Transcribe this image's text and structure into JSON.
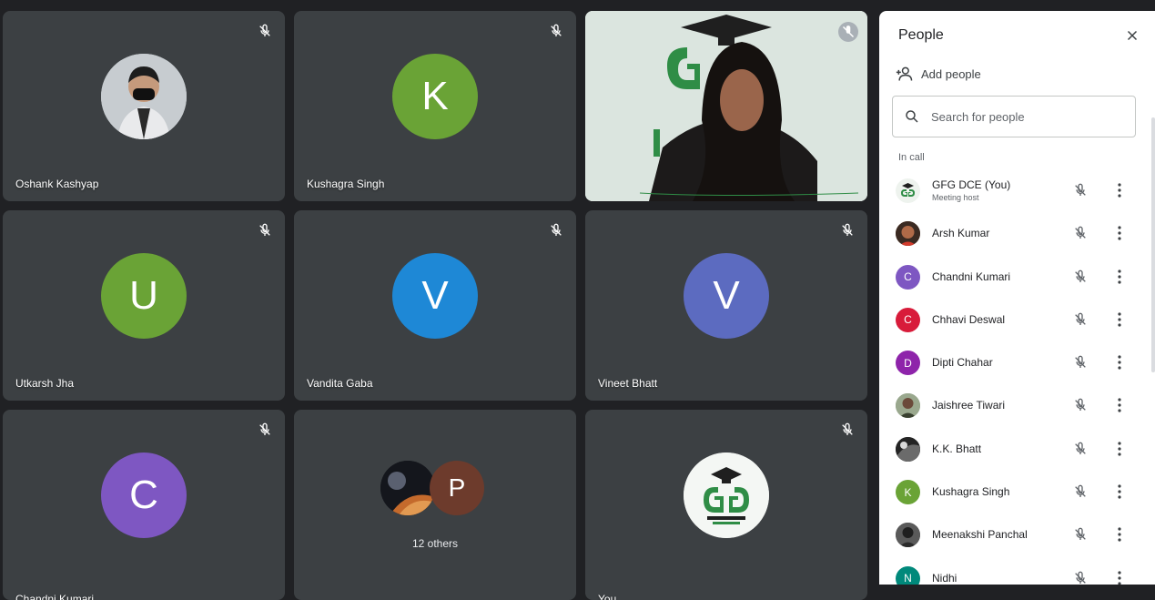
{
  "tiles": [
    {
      "name": "Oshank Kashyap",
      "kind": "photo",
      "avatar": "person-photo-icon"
    },
    {
      "name": "Kushagra Singh",
      "kind": "letter",
      "letter": "K",
      "color": "#6aa336"
    },
    {
      "name": "",
      "kind": "video"
    },
    {
      "name": "Utkarsh Jha",
      "kind": "letter",
      "letter": "U",
      "color": "#6aa336"
    },
    {
      "name": "Vandita Gaba",
      "kind": "letter",
      "letter": "V",
      "color": "#1e88d6"
    },
    {
      "name": "Vineet Bhatt",
      "kind": "letter",
      "letter": "V",
      "color": "#5c6bc0"
    },
    {
      "name": "Chandni Kumari",
      "kind": "letter",
      "letter": "C",
      "color": "#7e57c2"
    },
    {
      "name": "12 others",
      "kind": "others",
      "letter": "P"
    },
    {
      "name": "You",
      "kind": "logo"
    }
  ],
  "panel": {
    "title": "People",
    "add_people": "Add people",
    "search_placeholder": "Search for people",
    "section": "In call",
    "participants": [
      {
        "name": "GFG DCE (You)",
        "sub": "Meeting host",
        "avatar": "logo",
        "color": "#e8f0e8"
      },
      {
        "name": "Arsh Kumar",
        "sub": "",
        "avatar": "photo",
        "color": "#8b4a2c"
      },
      {
        "name": "Chandni Kumari",
        "sub": "",
        "avatar": "C",
        "color": "#7e57c2"
      },
      {
        "name": "Chhavi Deswal",
        "sub": "",
        "avatar": "C",
        "color": "#d81b3a"
      },
      {
        "name": "Dipti Chahar",
        "sub": "",
        "avatar": "D",
        "color": "#8e24aa"
      },
      {
        "name": "Jaishree Tiwari",
        "sub": "",
        "avatar": "photo",
        "color": "#7a8f6f"
      },
      {
        "name": "K.K. Bhatt",
        "sub": "",
        "avatar": "photo",
        "color": "#3a3a3a"
      },
      {
        "name": "Kushagra Singh",
        "sub": "",
        "avatar": "K",
        "color": "#6aa336"
      },
      {
        "name": "Meenakshi Panchal",
        "sub": "",
        "avatar": "photo",
        "color": "#4a4a4a"
      },
      {
        "name": "Nidhi",
        "sub": "",
        "avatar": "N",
        "color": "#00897b"
      }
    ]
  }
}
